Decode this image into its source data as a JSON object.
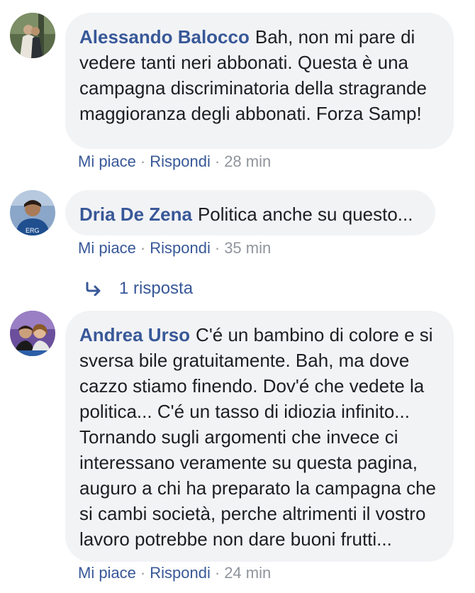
{
  "comments": [
    {
      "author": "Alessando Balocco",
      "text": "Bah, non mi pare di vedere tanti neri abbonati. Questa è una campagna discriminatoria della stragrande maggioranza degli abbonati. Forza Samp!",
      "like_label": "Mi piace",
      "reply_label": "Rispondi",
      "time": "28 min"
    },
    {
      "author": "Dria De Zena",
      "text": "Politica anche su questo...",
      "like_label": "Mi piace",
      "reply_label": "Rispondi",
      "time": "35 min",
      "replies_label": "1 risposta"
    },
    {
      "author": "Andrea Urso",
      "text": "C'é un bambino di colore e si sversa bile gratuitamente. Bah, ma dove cazzo stiamo finendo. Dov'é che vedete la politica... C'é un tasso di idiozia infinito... Tornando sugli argomenti che invece ci interessano veramente su questa pagina, auguro a chi ha preparato la campagna che si cambi società, perche altrimenti il vostro lavoro potrebbe non dare buoni frutti...",
      "like_label": "Mi piace",
      "reply_label": "Rispondi",
      "time": "24 min"
    }
  ],
  "separator": "·",
  "icons": {
    "reply_arrow": "reply-arrow-icon"
  },
  "colors": {
    "link": "#385898",
    "bubble": "#f2f3f5",
    "meta": "#90949c"
  }
}
